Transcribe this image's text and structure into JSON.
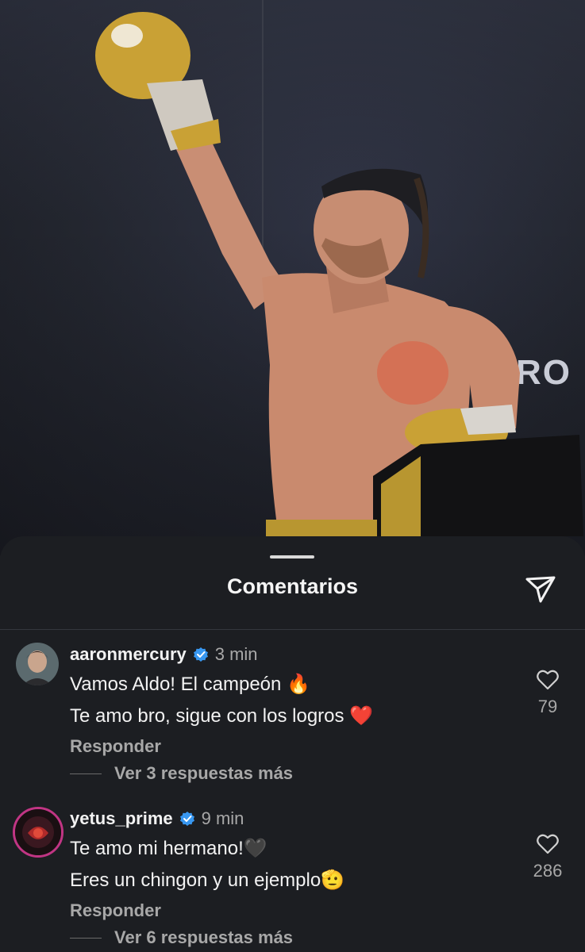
{
  "sheet": {
    "title": "Comentarios",
    "send_icon": "send-icon"
  },
  "photo": {
    "wall_text": "RO"
  },
  "comments": [
    {
      "username": "aaronmercury",
      "verified": true,
      "time": "3 min",
      "lines": [
        "Vamos Aldo! El campeón 🔥",
        "Te amo bro, sigue con los logros ❤️"
      ],
      "likes": "79",
      "reply_label": "Responder",
      "view_replies": "Ver 3 respuestas más"
    },
    {
      "username": "yetus_prime",
      "verified": true,
      "time": "9 min",
      "lines": [
        "Te amo mi hermano!🖤",
        "Eres un chingon y un ejemplo🫡"
      ],
      "likes": "286",
      "reply_label": "Responder",
      "view_replies": "Ver 6 respuestas más"
    }
  ],
  "colors": {
    "sheet_bg": "#1c1e22",
    "verified_blue": "#3897f0",
    "muted_text": "#a8a8a8"
  }
}
